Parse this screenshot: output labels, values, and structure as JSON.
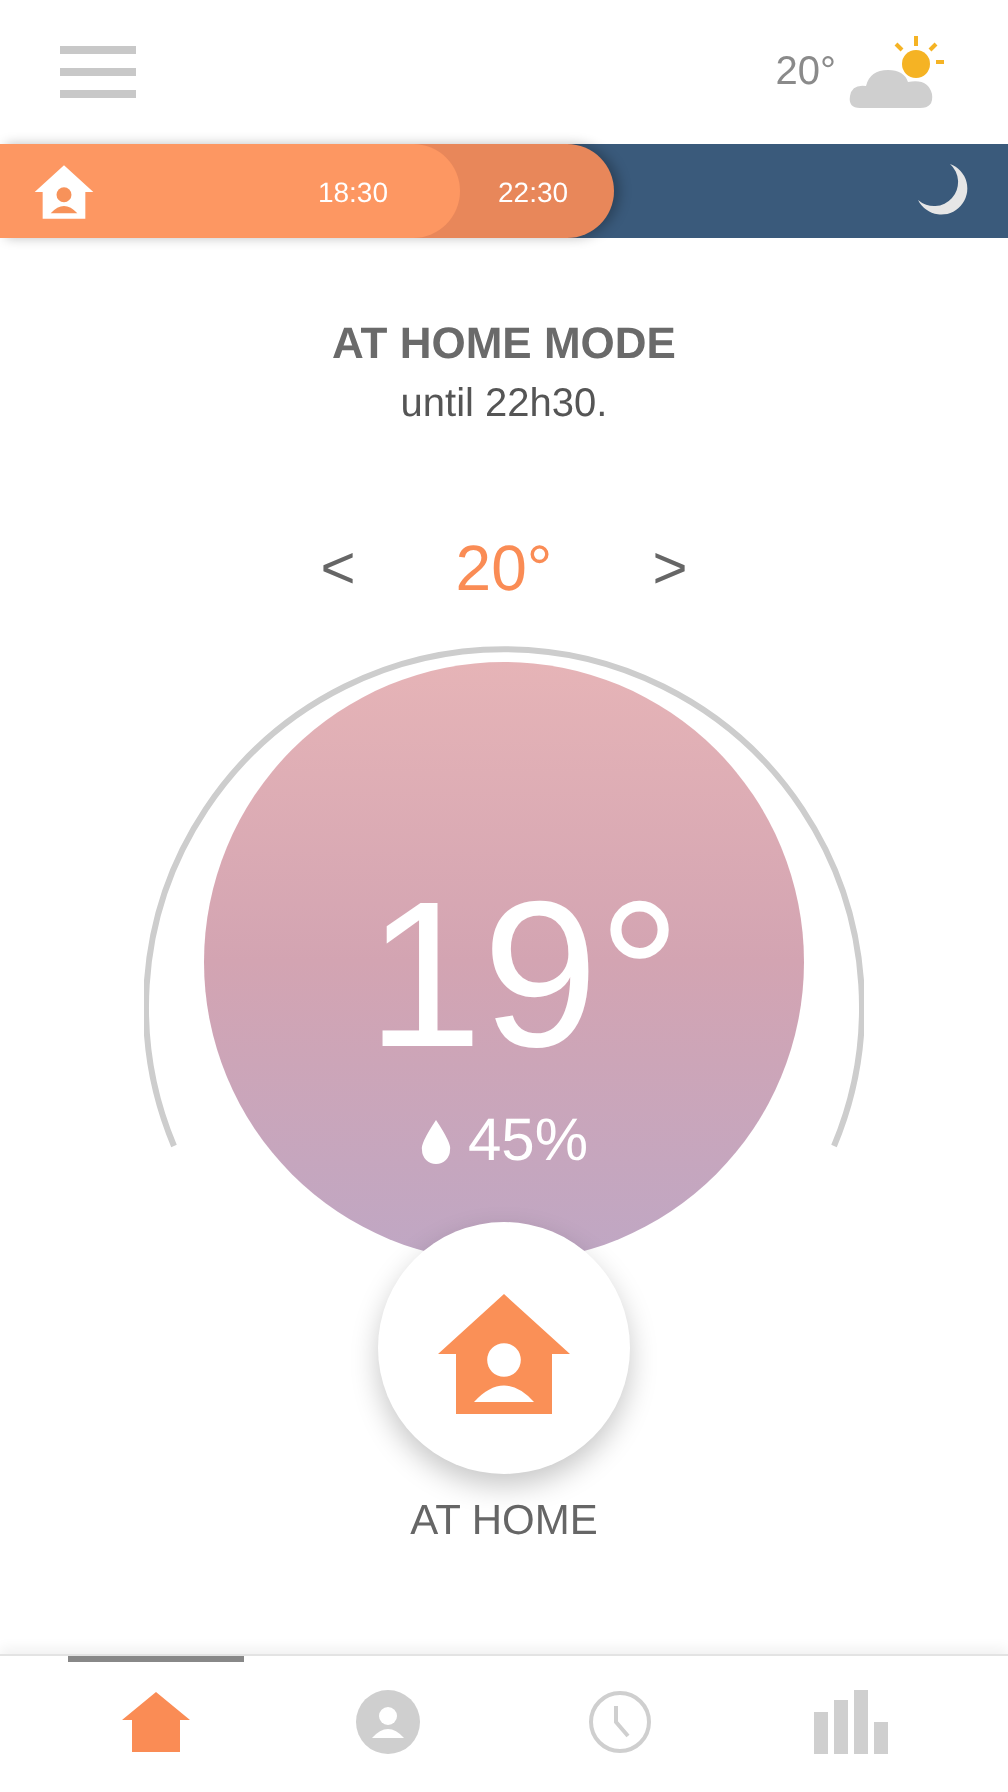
{
  "header": {
    "weather_temp": "20°"
  },
  "timeline": {
    "segments": [
      {
        "kind": "home",
        "time": "18:30"
      },
      {
        "kind": "home-late",
        "time": "22:30"
      },
      {
        "kind": "night"
      }
    ]
  },
  "mode": {
    "title": "AT HOME MODE",
    "subtitle": "until 22h30."
  },
  "setpoint": {
    "decrease": "<",
    "value": "20°",
    "increase": ">"
  },
  "dial": {
    "temperature": "19°",
    "humidity": "45%",
    "mode_label": "AT HOME"
  },
  "tabs": [
    {
      "kind": "home",
      "selected": true
    },
    {
      "kind": "profile",
      "selected": false
    },
    {
      "kind": "schedule",
      "selected": false
    },
    {
      "kind": "stats",
      "selected": false
    }
  ]
}
